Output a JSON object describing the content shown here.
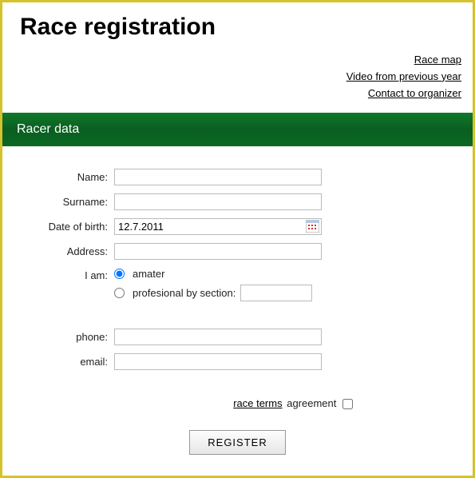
{
  "title": "Race registration",
  "links": {
    "map": "Race map",
    "video": "Video from previous year",
    "contact": "Contact to organizer"
  },
  "section": {
    "header": "Racer data"
  },
  "form": {
    "name_label": "Name:",
    "surname_label": "Surname:",
    "dob_label": "Date of birth:",
    "dob_value": "12.7.2011",
    "address_label": "Address:",
    "iam_label": "I am:",
    "amater_label": "amater",
    "profesional_label": "profesional by section:",
    "phone_label": "phone:",
    "email_label": "email:",
    "terms_link": "race terms",
    "terms_agree": "agreement",
    "register": "REGISTER"
  }
}
